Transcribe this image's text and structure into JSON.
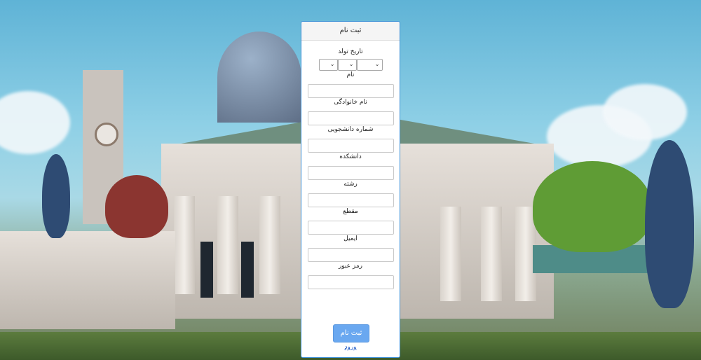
{
  "colors": {
    "panel_border": "#3b8fd6",
    "button_bg": "#6aa8f0",
    "link": "#1a56c4"
  },
  "form": {
    "title": "ثبت نام",
    "birth_date": {
      "label": "تاریخ تولد",
      "selects": [
        {
          "value": "",
          "icon": "chevron-down-icon"
        },
        {
          "value": "",
          "icon": "chevron-down-icon"
        },
        {
          "value": "",
          "icon": "chevron-down-icon"
        }
      ]
    },
    "fields": [
      {
        "label": "نام",
        "value": ""
      },
      {
        "label": "نام خانوادگی",
        "value": ""
      },
      {
        "label": "شماره دانشجویی",
        "value": ""
      },
      {
        "label": "دانشکده",
        "value": ""
      },
      {
        "label": "رشته",
        "value": ""
      },
      {
        "label": "مقطع",
        "value": ""
      },
      {
        "label": "ایمیل",
        "value": ""
      },
      {
        "label": "رمز عبور",
        "value": ""
      }
    ],
    "submit_label": "ثبت نام",
    "login_link": "ورود"
  }
}
